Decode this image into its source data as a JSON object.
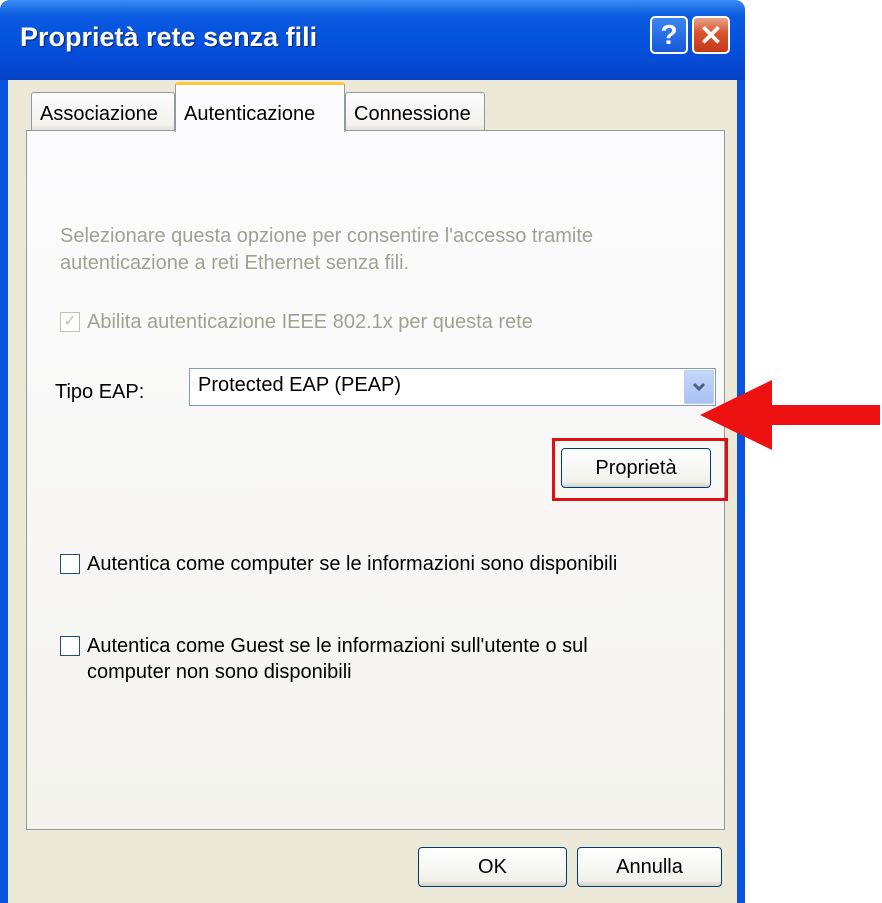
{
  "window": {
    "title": "Proprietà rete senza fili",
    "help_glyph": "?",
    "close_glyph": "✕"
  },
  "tabs": [
    {
      "label": "Associazione"
    },
    {
      "label": "Autenticazione"
    },
    {
      "label": "Connessione"
    }
  ],
  "auth": {
    "description": "Selezionare questa opzione per consentire l'accesso tramite autenticazione a reti Ethernet senza fili.",
    "enable_8021x_label": "Abilita autenticazione IEEE 802.1x per questa rete",
    "eap_type_label": "Tipo EAP:",
    "eap_type_value": "Protected EAP (PEAP)",
    "properties_button": "Proprietà",
    "auth_as_computer_label": "Autentica come computer se le informazioni sono disponibili",
    "auth_as_guest_label": "Autentica come Guest se le informazioni sull'utente o sul computer non sono disponibili"
  },
  "footer": {
    "ok_label": "OK",
    "cancel_label": "Annulla"
  },
  "colors": {
    "highlight": "#e01010",
    "arrow": "#ee1111"
  }
}
